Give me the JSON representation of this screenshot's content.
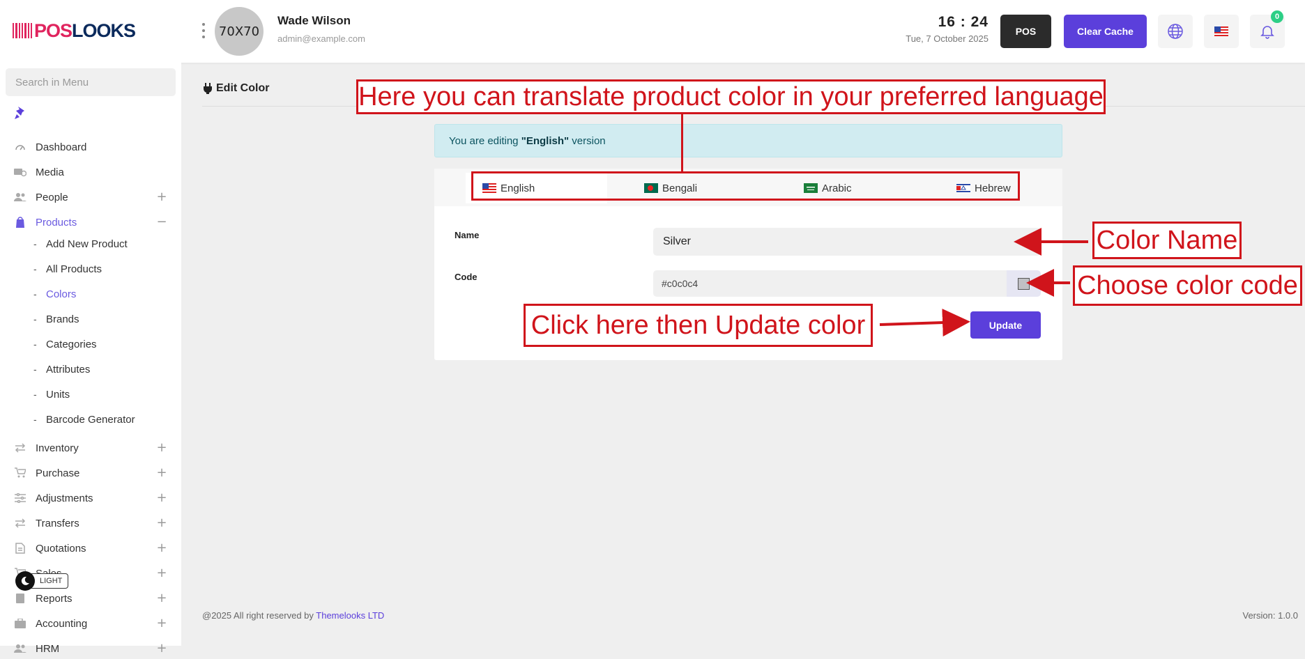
{
  "brand": {
    "logo_part1": "POS",
    "logo_part2": "LOOKS",
    "primary_color": "#5b3fdb",
    "logo_red": "#e0245e",
    "logo_navy": "#0b2a5c"
  },
  "header": {
    "avatar_text": "70X70",
    "user_name": "Wade Wilson",
    "user_email": "admin@example.com",
    "clock": "16 : 24",
    "date": "Tue, 7 October 2025",
    "pos_label": "POS",
    "clear_cache_label": "Clear Cache",
    "notification_count": "0"
  },
  "sidebar": {
    "search_placeholder": "Search in Menu",
    "items": [
      {
        "label": "Dashboard",
        "icon": "gauge-icon"
      },
      {
        "label": "Media",
        "icon": "media-icon"
      },
      {
        "label": "People",
        "icon": "people-icon",
        "expand": "+"
      },
      {
        "label": "Products",
        "icon": "bag-icon",
        "expand": "−",
        "active": true
      },
      {
        "label": "Inventory",
        "icon": "swap-icon",
        "expand": "+"
      },
      {
        "label": "Purchase",
        "icon": "cart-icon",
        "expand": "+"
      },
      {
        "label": "Adjustments",
        "icon": "sliders-icon",
        "expand": "+"
      },
      {
        "label": "Transfers",
        "icon": "swap-icon",
        "expand": "+"
      },
      {
        "label": "Quotations",
        "icon": "document-icon",
        "expand": "+"
      },
      {
        "label": "Sales",
        "icon": "cart-icon",
        "expand": "+"
      },
      {
        "label": "Reports",
        "icon": "report-icon",
        "expand": "+"
      },
      {
        "label": "Accounting",
        "icon": "briefcase-icon",
        "expand": "+"
      },
      {
        "label": "HRM",
        "icon": "people-icon",
        "expand": "+"
      }
    ],
    "product_sub": [
      {
        "label": "Add New Product"
      },
      {
        "label": "All Products"
      },
      {
        "label": "Colors",
        "active": true
      },
      {
        "label": "Brands"
      },
      {
        "label": "Categories"
      },
      {
        "label": "Attributes"
      },
      {
        "label": "Units"
      },
      {
        "label": "Barcode Generator"
      }
    ],
    "theme_label": "LIGHT"
  },
  "main": {
    "page_title": "Edit Color",
    "alert_prefix": "You are editing ",
    "alert_language": "\"English\"",
    "alert_suffix": " version",
    "tabs": [
      {
        "label": "English",
        "flag": "us-flag-icon"
      },
      {
        "label": "Bengali",
        "flag": "bd-flag-icon"
      },
      {
        "label": "Arabic",
        "flag": "sa-flag-icon"
      },
      {
        "label": "Hebrew",
        "flag": "il-flag-icon"
      }
    ],
    "name_label": "Name",
    "name_value": "Silver",
    "code_label": "Code",
    "code_value": "#c0c0c4",
    "swatch_color": "#c0c0c4",
    "update_label": "Update"
  },
  "footer": {
    "copyright_prefix": "@2025 All right reserved by ",
    "company": "Themelooks LTD",
    "version": "Version: 1.0.0"
  },
  "annotations": {
    "translate": "Here you can translate product color in your preferred language",
    "color_name": "Color Name",
    "color_code": "Choose color code",
    "update": "Click here then Update color",
    "color": "#d0141b"
  }
}
